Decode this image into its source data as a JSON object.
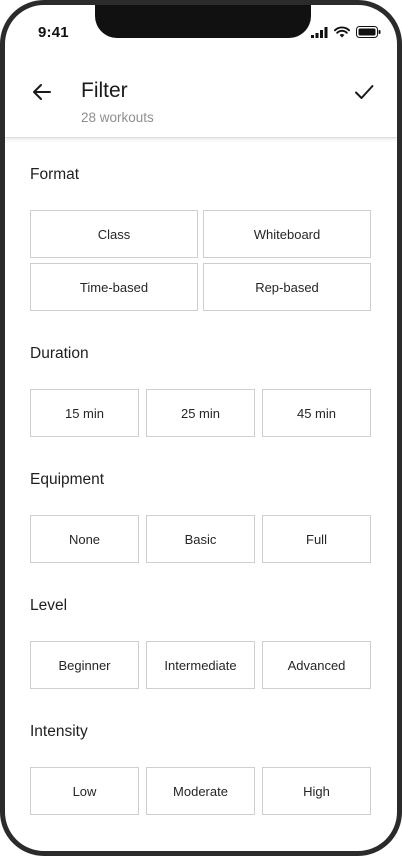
{
  "status_bar": {
    "time": "9:41"
  },
  "header": {
    "title": "Filter",
    "subtitle": "28 workouts"
  },
  "sections": {
    "format": {
      "title": "Format",
      "options": [
        "Class",
        "Whiteboard",
        "Time-based",
        "Rep-based"
      ]
    },
    "duration": {
      "title": "Duration",
      "options": [
        "15 min",
        "25 min",
        "45 min"
      ]
    },
    "equipment": {
      "title": "Equipment",
      "options": [
        "None",
        "Basic",
        "Full"
      ]
    },
    "level": {
      "title": "Level",
      "options": [
        "Beginner",
        "Intermediate",
        "Advanced"
      ]
    },
    "intensity": {
      "title": "Intensity",
      "options": [
        "Low",
        "Moderate",
        "High"
      ]
    }
  },
  "colors": {
    "text": "#1a1a1a",
    "muted": "#8f8f8f",
    "border": "#cfcfcf",
    "frame": "#2b2b2b"
  },
  "icons": {
    "back": "arrow-left-icon",
    "apply": "check-icon",
    "signal": "cellular-signal-icon",
    "wifi": "wifi-icon",
    "battery": "battery-icon"
  }
}
